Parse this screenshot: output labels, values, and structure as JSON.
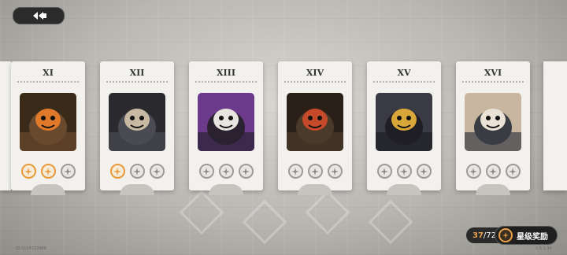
{
  "nav": {
    "back_icon": "double-chevron-left-icon"
  },
  "cards": [
    {
      "numeral": "XI",
      "stars": [
        true,
        true,
        false
      ],
      "portrait": "flame-bear-icon"
    },
    {
      "numeral": "XII",
      "stars": [
        true,
        false,
        false
      ],
      "portrait": "armored-ogre-icon"
    },
    {
      "numeral": "XIII",
      "stars": [
        false,
        false,
        false
      ],
      "portrait": "masked-creature-icon"
    },
    {
      "numeral": "XIV",
      "stars": [
        false,
        false,
        false
      ],
      "portrait": "horned-beast-icon"
    },
    {
      "numeral": "XV",
      "stars": [
        false,
        false,
        false
      ],
      "portrait": "shadow-knight-icon"
    },
    {
      "numeral": "XVI",
      "stars": [
        false,
        false,
        false
      ],
      "portrait": "cat-eared-girl-icon"
    }
  ],
  "progress": {
    "current": "37",
    "separator": "/",
    "total": "72"
  },
  "reward_button": {
    "label": "星级奖励",
    "icon": "star-coin-icon"
  },
  "footer": {
    "id_text": "ID:3114152480",
    "version": "1.5.1.34"
  },
  "colors": {
    "accent": "#e8a04a",
    "card": "#f2f1ee"
  }
}
